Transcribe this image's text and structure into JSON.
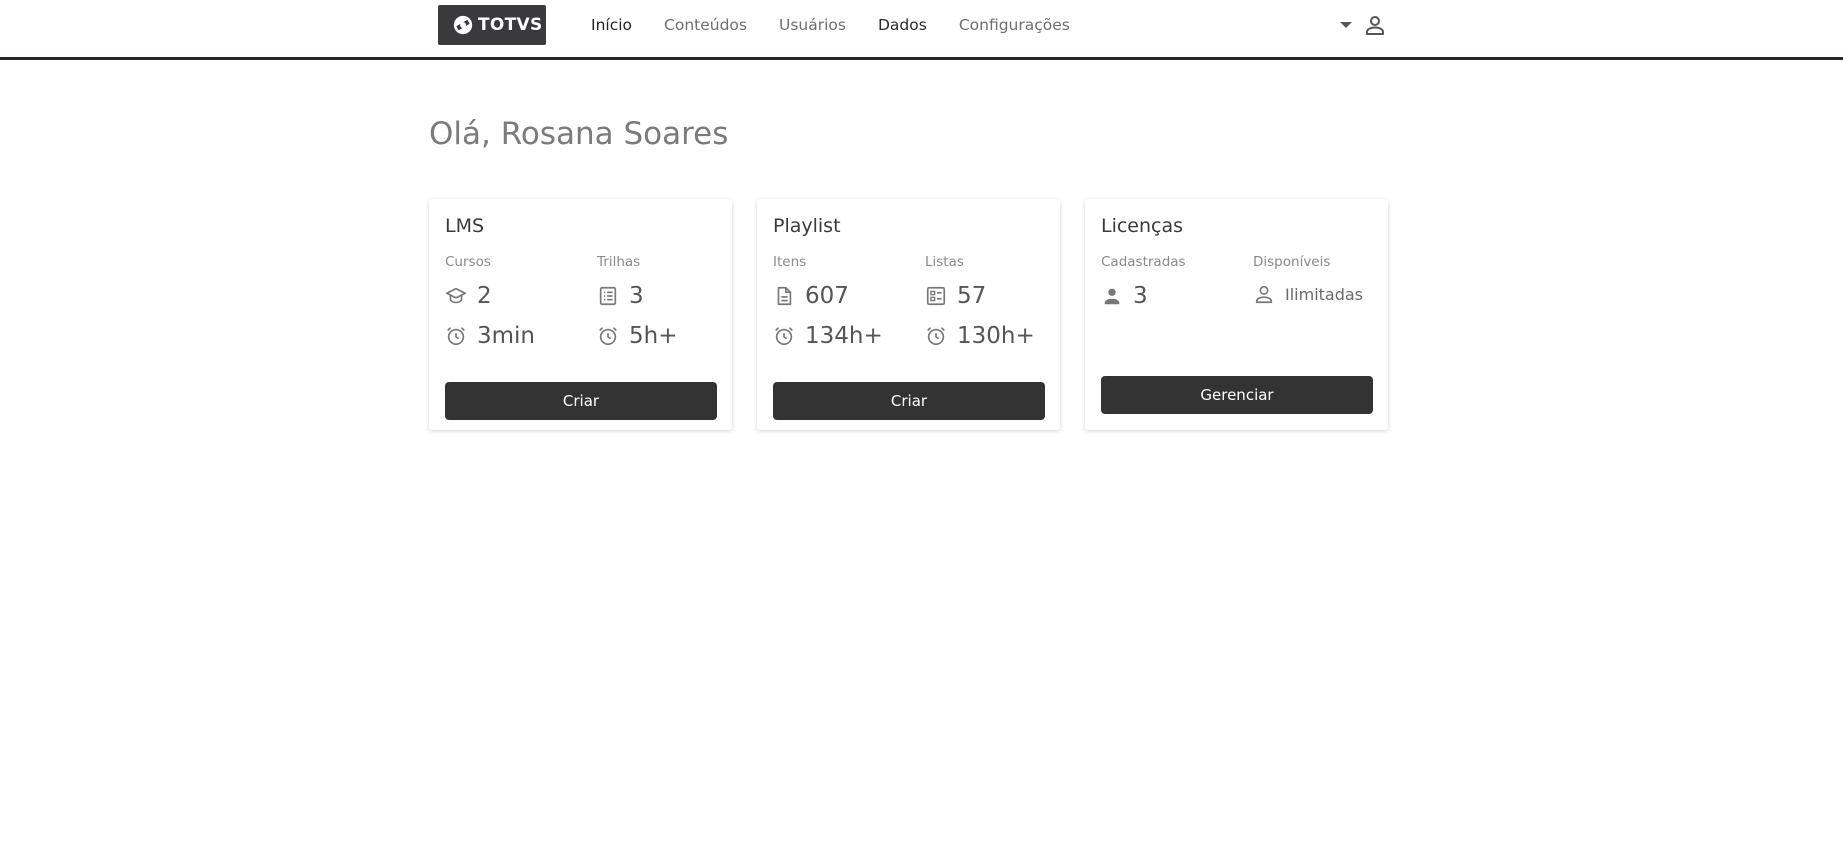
{
  "header": {
    "logo_text": "TOTVS",
    "nav": [
      {
        "label": "Início"
      },
      {
        "label": "Conteúdos"
      },
      {
        "label": "Usuários"
      },
      {
        "label": "Dados"
      },
      {
        "label": "Configurações"
      }
    ],
    "user_menu_icon": "chevron-down-icon",
    "user_icon": "user-icon",
    "accent_color": "#2c2423"
  },
  "greeting": "Olá, Rosana Soares",
  "cards": {
    "lms": {
      "title": "LMS",
      "col1_label": "Cursos",
      "col2_label": "Trilhas",
      "courses_count": "2",
      "trails_count": "3",
      "courses_time": "3min",
      "trails_time": "5h+",
      "button_label": "Criar"
    },
    "playlist": {
      "title": "Playlist",
      "col1_label": "Itens",
      "col2_label": "Listas",
      "items_count": "607",
      "lists_count": "57",
      "items_time": "134h+",
      "lists_time": "130h+",
      "button_label": "Criar"
    },
    "licenses": {
      "title": "Licenças",
      "col1_label": "Cadastradas",
      "col2_label": "Disponíveis",
      "registered": "3",
      "available": "Ilimitadas",
      "button_label": "Gerenciar"
    }
  },
  "colors": {
    "button_bg": "#333333",
    "greeting": "#7b7b7b",
    "card_title": "#3a3a3a"
  }
}
